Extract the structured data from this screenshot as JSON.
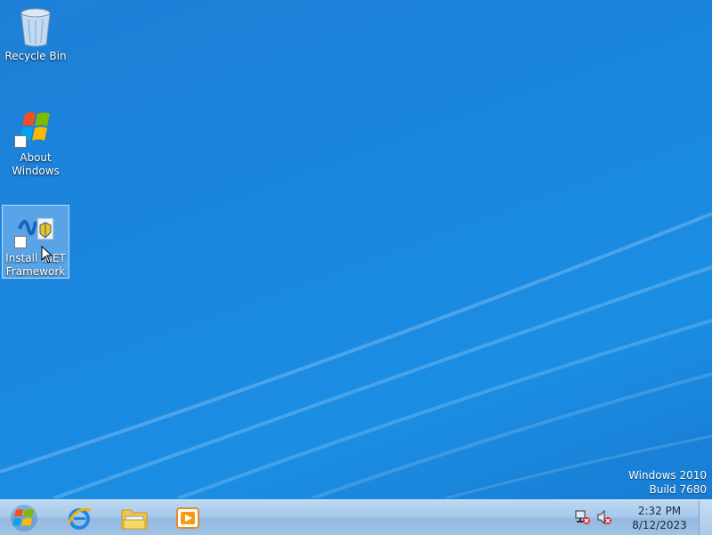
{
  "desktop": {
    "icons": [
      {
        "label": "Recycle Bin",
        "icon": "recycle-bin-icon"
      },
      {
        "label": "About\nWindows",
        "icon": "windows-flag-icon",
        "shortcut": true
      },
      {
        "label": "Install .NET\nFramework",
        "icon": "dotnet-installer-icon",
        "shortcut": true,
        "selected": true
      }
    ],
    "watermark": {
      "line1": "Windows 2010",
      "line2": "Build 7680"
    }
  },
  "taskbar": {
    "buttons": [
      {
        "name": "start",
        "icon": "windows-start-orb-icon"
      },
      {
        "name": "internet-explorer",
        "icon": "internet-explorer-icon"
      },
      {
        "name": "file-explorer",
        "icon": "folder-icon"
      },
      {
        "name": "media-player",
        "icon": "media-player-icon"
      }
    ],
    "tray": {
      "network_icon": "network-disconnected-icon",
      "volume_icon": "volume-muted-icon"
    },
    "clock": {
      "time": "2:32 PM",
      "date": "8/12/2023"
    }
  },
  "colors": {
    "wallpaper": "#1b86dd",
    "taskbar": "#a8c9ea",
    "text": "#ffffff"
  }
}
